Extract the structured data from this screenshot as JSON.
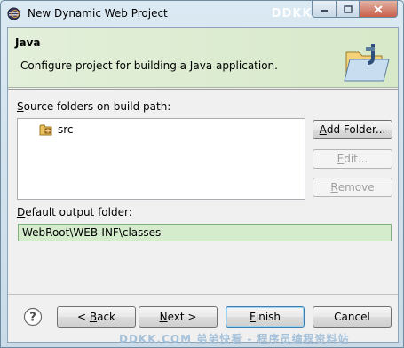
{
  "window": {
    "title": "New Dynamic Web Project",
    "watermark_top": "DDKK.COM"
  },
  "banner": {
    "title": "Java",
    "description": "Configure project for building a Java application.",
    "icon": "java-folder-icon"
  },
  "source_folders": {
    "label_prefix": "",
    "label_mnemonic": "S",
    "label_rest": "ource folders on build path:",
    "items": [
      {
        "label": "src",
        "icon": "package-folder-icon"
      }
    ]
  },
  "buttons": {
    "add_folder": {
      "mnemonic": "A",
      "rest": "dd Folder..."
    },
    "edit": {
      "mnemonic": "E",
      "rest": "dit..."
    },
    "remove": {
      "mnemonic": "R",
      "rest": "emove"
    },
    "back": {
      "prefix": "< ",
      "mnemonic": "B",
      "rest": "ack"
    },
    "next": {
      "mnemonic": "N",
      "rest": "ext >"
    },
    "finish": {
      "mnemonic": "F",
      "rest": "inish"
    },
    "cancel": {
      "label": "Cancel"
    }
  },
  "output_folder": {
    "label_mnemonic": "D",
    "label_rest": "efault output folder:",
    "value": "WebRoot\\WEB-INF\\classes"
  },
  "footer": {
    "watermark": "DDKK.COM 弟弟快看 - 程序员编程资料站",
    "help_icon": "help-icon"
  }
}
